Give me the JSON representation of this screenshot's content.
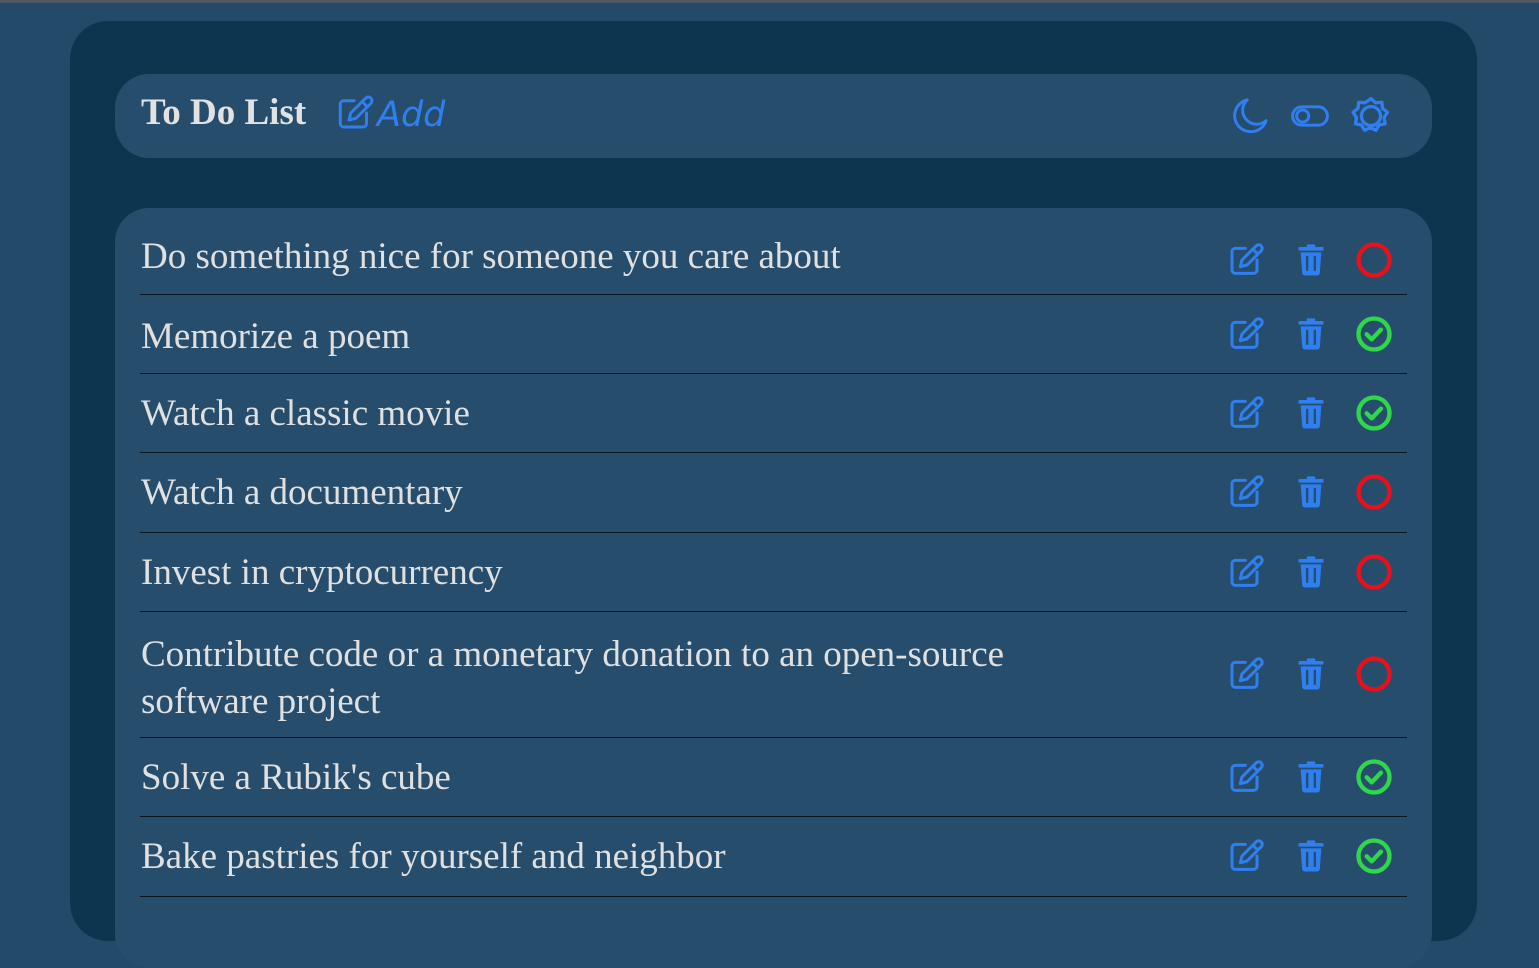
{
  "header": {
    "title": "To Do List",
    "add_label": "Add",
    "icons": [
      "moon-icon",
      "toggle-icon",
      "sun-icon"
    ]
  },
  "todos": [
    {
      "text": "Do something nice for someone you care about",
      "done": false
    },
    {
      "text": "Memorize a poem",
      "done": true
    },
    {
      "text": "Watch a classic movie",
      "done": true
    },
    {
      "text": "Watch a documentary",
      "done": false
    },
    {
      "text": "Invest in cryptocurrency",
      "done": false
    },
    {
      "text": "Contribute code or a monetary donation to an open-source software project",
      "done": false
    },
    {
      "text": "Solve a Rubik's cube",
      "done": true
    },
    {
      "text": "Bake pastries for yourself and neighbor",
      "done": true
    }
  ],
  "colors": {
    "accent": "#2f7ff0",
    "done": "#2fd84a",
    "not_done": "#e8111b",
    "text": "#e0e0e0"
  }
}
